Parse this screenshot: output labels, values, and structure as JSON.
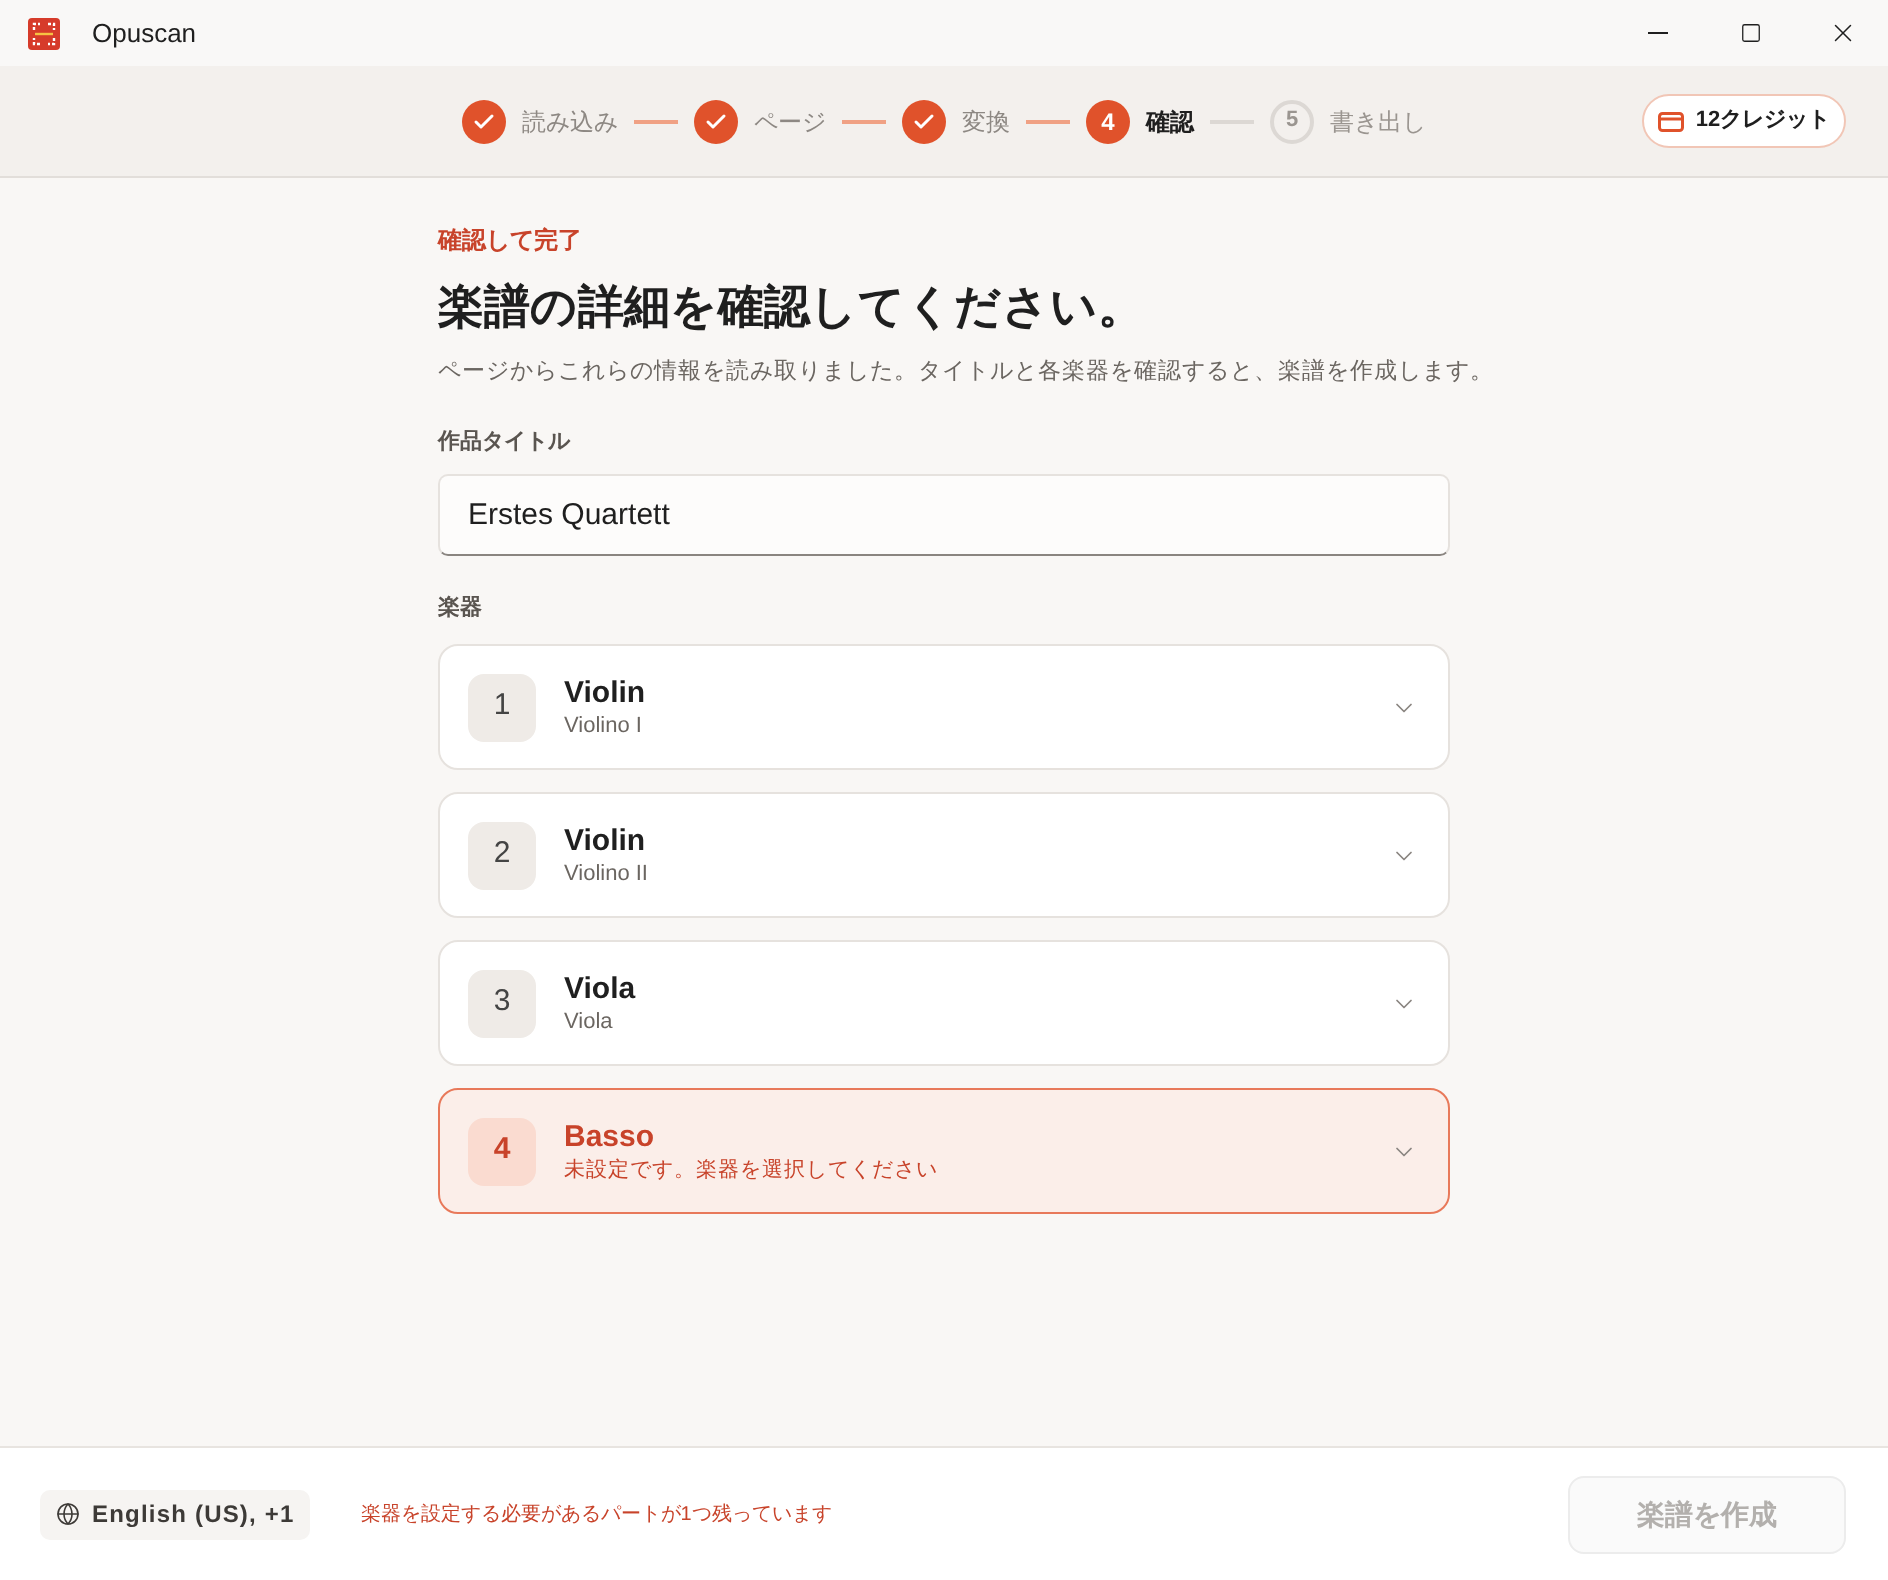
{
  "window": {
    "title": "Opuscan"
  },
  "steps": [
    {
      "label": "読み込み",
      "completed": true,
      "selected": false
    },
    {
      "label": "ページ",
      "completed": true,
      "selected": false
    },
    {
      "label": "変換",
      "completed": true,
      "selected": false
    },
    {
      "number": "4",
      "label": "確認",
      "completed": false,
      "selected": true
    },
    {
      "number": "5",
      "label": "書き出し",
      "completed": false,
      "selected": false
    }
  ],
  "credits": {
    "label": "12クレジット"
  },
  "page": {
    "eyebrow": "確認して完了",
    "heading": "楽譜の詳細を確認してください。",
    "description": "ページからこれらの情報を読み取りました。タイトルと各楽器を確認すると、楽譜を作成します。"
  },
  "title_field": {
    "label": "作品タイトル",
    "value": "Erstes Quartett"
  },
  "instruments": {
    "label": "楽器",
    "items": [
      {
        "number": "1",
        "name": "Violin",
        "detail": "Violino I",
        "missing": false
      },
      {
        "number": "2",
        "name": "Violin",
        "detail": "Violino II",
        "missing": false
      },
      {
        "number": "3",
        "name": "Viola",
        "detail": "Viola",
        "missing": false
      },
      {
        "number": "4",
        "name": "Basso",
        "detail": "未設定です。楽器を選択してください",
        "missing": true
      }
    ]
  },
  "footer": {
    "language": "English (US), +1",
    "warning": "楽器を設定する必要があるパートが1つ残っています",
    "create_button": {
      "label": "楽譜を作成",
      "disabled": true
    }
  }
}
